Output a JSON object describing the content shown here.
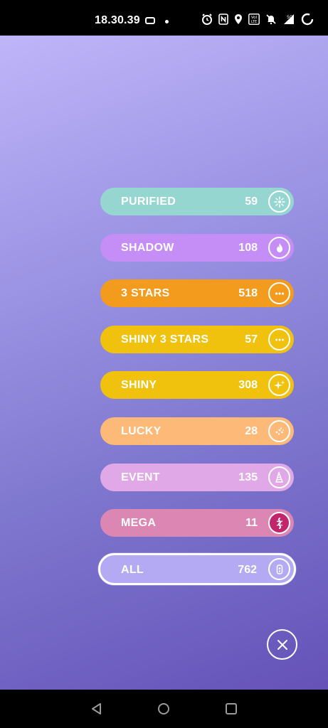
{
  "status_bar": {
    "time": "18.30.39",
    "icons": [
      "game-controller-icon",
      "alarm-icon",
      "nfc-icon",
      "location-icon",
      "volte-icon",
      "mute-icon",
      "signal-5g-icon",
      "battery-icon"
    ]
  },
  "filters": [
    {
      "label": "PURIFIED",
      "count": "59",
      "color": "#95d6d0",
      "icon": "purified-icon"
    },
    {
      "label": "SHADOW",
      "count": "108",
      "color": "#c58ef7",
      "icon": "shadow-flame-icon"
    },
    {
      "label": "3 STARS",
      "count": "518",
      "color": "#f39b1c",
      "icon": "three-stars-icon"
    },
    {
      "label": "SHINY 3 STARS",
      "count": "57",
      "color": "#f1c20d",
      "icon": "shiny-three-stars-icon"
    },
    {
      "label": "SHINY",
      "count": "308",
      "color": "#f1c20d",
      "icon": "sparkles-icon"
    },
    {
      "label": "LUCKY",
      "count": "28",
      "color": "#fcb977",
      "icon": "lucky-icon"
    },
    {
      "label": "EVENT",
      "count": "135",
      "color": "#e0a8e7",
      "icon": "party-hat-icon"
    },
    {
      "label": "MEGA",
      "count": "11",
      "color": "#dc86b4",
      "icon": "mega-icon"
    },
    {
      "label": "ALL",
      "count": "762",
      "color": "#b4aaf3",
      "icon": "pokeball-all-icon",
      "selected": true
    }
  ],
  "close_button": {
    "icon": "close-icon"
  },
  "nav_bar": {
    "icons": [
      "back-icon",
      "home-icon",
      "recents-icon"
    ]
  }
}
